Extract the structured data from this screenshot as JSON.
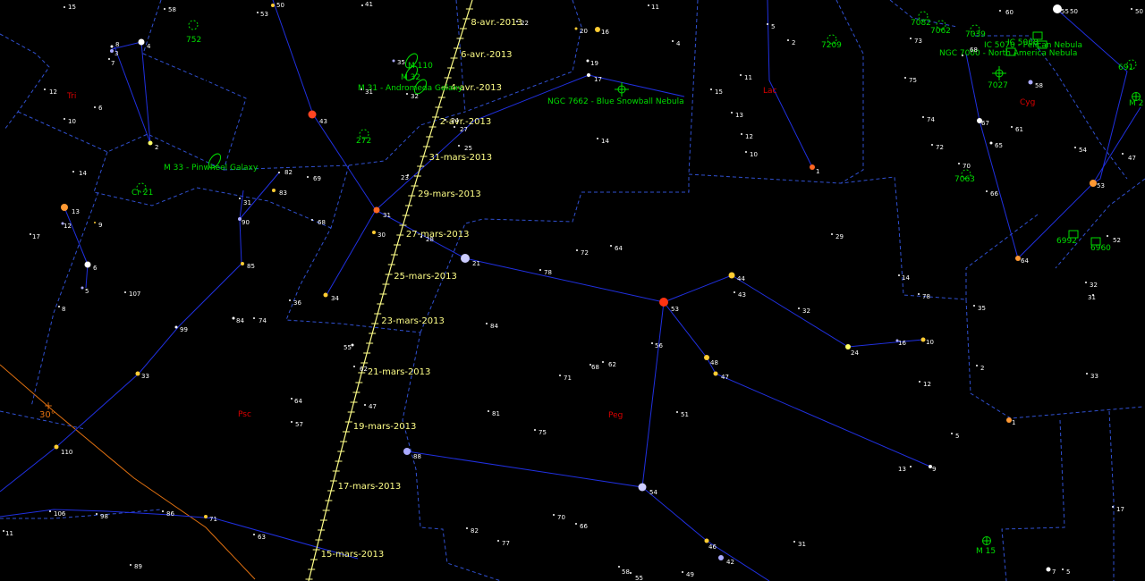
{
  "colors": {
    "background": "#000000",
    "boundary": "#3050d0",
    "constellation_line": "#2030e0",
    "constellation_name": "#dd0000",
    "deep_sky": "#00dd00",
    "star_label": "#ffffff",
    "comet_track": "#ffff88",
    "grid_line": "#e07010"
  },
  "grid_label": "30°",
  "constellations": [
    {
      "name": "Tri"
    },
    {
      "name": "Psc"
    },
    {
      "name": "Peg"
    },
    {
      "name": "Lac"
    },
    {
      "name": "Cyg"
    }
  ],
  "comet_dates": [
    "8-avr.-2013",
    "6-avr.-2013",
    "4-avr.-2013",
    "2-avr.-2013",
    "31-mars-2013",
    "29-mars-2013",
    "27-mars-2013",
    "25-mars-2013",
    "23-mars-2013",
    "21-mars-2013",
    "19-mars-2013",
    "17-mars-2013",
    "15-mars-2013"
  ],
  "deep_sky_objects": [
    {
      "label": "752",
      "icon": "open-cluster-icon"
    },
    {
      "label": "M 110",
      "icon": "galaxy-icon"
    },
    {
      "label": "M 32",
      "icon": "galaxy-icon"
    },
    {
      "label": "M 31 - Andromeda Galaxy",
      "icon": "galaxy-icon"
    },
    {
      "label": "272",
      "icon": "open-cluster-icon"
    },
    {
      "label": "M 33 - Pinwheel Galaxy",
      "icon": "galaxy-icon"
    },
    {
      "label": "Cr 21",
      "icon": "open-cluster-icon"
    },
    {
      "label": "NGC 7662 - Blue Snowball Nebula",
      "icon": "planetary-nebula-icon"
    },
    {
      "label": "7209",
      "icon": "open-cluster-icon"
    },
    {
      "label": "7082",
      "icon": "open-cluster-icon"
    },
    {
      "label": "7062",
      "icon": "open-cluster-icon"
    },
    {
      "label": "7039",
      "icon": "open-cluster-icon"
    },
    {
      "label": "IC 5068",
      "icon": "nebula-icon"
    },
    {
      "label": "IC 5070 - Pelican Nebula",
      "icon": "nebula-icon"
    },
    {
      "label": "NGC 7000 - North America Nebula",
      "icon": "nebula-icon"
    },
    {
      "label": "7027",
      "icon": "planetary-nebula-icon"
    },
    {
      "label": "7063",
      "icon": "open-cluster-icon"
    },
    {
      "label": "6992",
      "icon": "nebula-icon"
    },
    {
      "label": "6960",
      "icon": "nebula-icon"
    },
    {
      "label": "M 15",
      "icon": "globular-cluster-icon"
    },
    {
      "label": "691",
      "icon": "open-cluster-icon"
    },
    {
      "label": "M 2",
      "icon": "globular-cluster-icon"
    }
  ],
  "stars": [
    {
      "label": "15",
      "color": "#ffffff"
    },
    {
      "label": "58",
      "color": "#ffffff"
    },
    {
      "label": "53",
      "color": "#ffffff"
    },
    {
      "label": "50",
      "color": "#ffcc33"
    },
    {
      "label": "41",
      "color": "#ffffff"
    },
    {
      "label": "22",
      "color": "#ffffff"
    },
    {
      "label": "11",
      "color": "#ffffff"
    },
    {
      "label": "50",
      "color": "#ffffff"
    },
    {
      "label": "8",
      "color": "#ffffff"
    },
    {
      "label": "3",
      "color": "#aaaaff"
    },
    {
      "label": "7",
      "color": "#ffffff"
    },
    {
      "label": "4",
      "color": "#ffffff"
    },
    {
      "label": "12",
      "color": "#ffffff"
    },
    {
      "label": "6",
      "color": "#ffffff"
    },
    {
      "label": "10",
      "color": "#ffffff"
    },
    {
      "label": "2",
      "color": "#ffff66"
    },
    {
      "label": "14",
      "color": "#ffffff"
    },
    {
      "label": "13",
      "color": "#ff9933"
    },
    {
      "label": "12",
      "color": "#aaaaff"
    },
    {
      "label": "9",
      "color": "#ffcc33"
    },
    {
      "label": "17",
      "color": "#ffffff"
    },
    {
      "label": "6",
      "color": "#ffffff"
    },
    {
      "label": "5",
      "color": "#aaaaff"
    },
    {
      "label": "8",
      "color": "#ffffff"
    },
    {
      "label": "107",
      "color": "#ffffff"
    },
    {
      "label": "35",
      "color": "#aaaaff"
    },
    {
      "label": "31",
      "color": "#ffffff"
    },
    {
      "label": "43",
      "color": "#ff4422"
    },
    {
      "label": "32",
      "color": "#ffffff"
    },
    {
      "label": "82",
      "color": "#ffffff"
    },
    {
      "label": "69",
      "color": "#ffffff"
    },
    {
      "label": "83",
      "color": "#ffcc33"
    },
    {
      "label": "31",
      "color": "#ffffff"
    },
    {
      "label": "90",
      "color": "#aaaaff"
    },
    {
      "label": "68",
      "color": "#ffffff"
    },
    {
      "label": "85",
      "color": "#ffcc33"
    },
    {
      "label": "84",
      "color": "#ffffff"
    },
    {
      "label": "74",
      "color": "#ffffff"
    },
    {
      "label": "36",
      "color": "#ffffff"
    },
    {
      "label": "99",
      "color": "#ffffff"
    },
    {
      "label": "33",
      "color": "#ffcc33"
    },
    {
      "label": "110",
      "color": "#ffcc33"
    },
    {
      "label": "106",
      "color": "#ffffff"
    },
    {
      "label": "98",
      "color": "#ffffff"
    },
    {
      "label": "86",
      "color": "#ffffff"
    },
    {
      "label": "71",
      "color": "#ffcc33"
    },
    {
      "label": "63",
      "color": "#ffffff"
    },
    {
      "label": "89",
      "color": "#ffffff"
    },
    {
      "label": "11",
      "color": "#ffffff"
    },
    {
      "label": "64",
      "color": "#ffffff"
    },
    {
      "label": "57",
      "color": "#ffffff"
    },
    {
      "label": "47",
      "color": "#ffffff"
    },
    {
      "label": "34",
      "color": "#ffcc33"
    },
    {
      "label": "30",
      "color": "#ffcc33"
    },
    {
      "label": "31",
      "color": "#ff6622"
    },
    {
      "label": "55",
      "color": "#ffffff"
    },
    {
      "label": "62",
      "color": "#ffffff"
    },
    {
      "label": "23",
      "color": "#ffffff"
    },
    {
      "label": "27",
      "color": "#ffffff"
    },
    {
      "label": "25",
      "color": "#ffffff"
    },
    {
      "label": "24",
      "color": "#ffffff"
    },
    {
      "label": "28",
      "color": "#ffffff"
    },
    {
      "label": "20",
      "color": "#ffcc33"
    },
    {
      "label": "16",
      "color": "#ffcc33"
    },
    {
      "label": "4",
      "color": "#ffffff"
    },
    {
      "label": "19",
      "color": "#ffffff"
    },
    {
      "label": "17",
      "color": "#ffffff"
    },
    {
      "label": "14",
      "color": "#ffffff"
    },
    {
      "label": "5",
      "color": "#ffffff"
    },
    {
      "label": "2",
      "color": "#ffffff"
    },
    {
      "label": "15",
      "color": "#ffffff"
    },
    {
      "label": "11",
      "color": "#ffffff"
    },
    {
      "label": "13",
      "color": "#ffffff"
    },
    {
      "label": "12",
      "color": "#ffffff"
    },
    {
      "label": "10",
      "color": "#ffffff"
    },
    {
      "label": "1",
      "color": "#ff6622"
    },
    {
      "label": "21",
      "color": "#ccccff"
    },
    {
      "label": "78",
      "color": "#ffffff"
    },
    {
      "label": "72",
      "color": "#ffffff"
    },
    {
      "label": "64",
      "color": "#ffffff"
    },
    {
      "label": "29",
      "color": "#ffffff"
    },
    {
      "label": "84",
      "color": "#ffffff"
    },
    {
      "label": "44",
      "color": "#ffcc33"
    },
    {
      "label": "43",
      "color": "#ffffff"
    },
    {
      "label": "53",
      "color": "#ff3311"
    },
    {
      "label": "32",
      "color": "#ffffff"
    },
    {
      "label": "56",
      "color": "#ffffff"
    },
    {
      "label": "48",
      "color": "#ffcc33"
    },
    {
      "label": "47",
      "color": "#ffcc33"
    },
    {
      "label": "71",
      "color": "#ffffff"
    },
    {
      "label": "68",
      "color": "#ffffff"
    },
    {
      "label": "62",
      "color": "#ffffff"
    },
    {
      "label": "81",
      "color": "#ffffff"
    },
    {
      "label": "75",
      "color": "#ffffff"
    },
    {
      "label": "51",
      "color": "#ffffff"
    },
    {
      "label": "24",
      "color": "#ffff66"
    },
    {
      "label": "16",
      "color": "#aaaaff"
    },
    {
      "label": "10",
      "color": "#ffcc33"
    },
    {
      "label": "88",
      "color": "#aaaaff"
    },
    {
      "label": "54",
      "color": "#ccccff"
    },
    {
      "label": "70",
      "color": "#ffffff"
    },
    {
      "label": "66",
      "color": "#ffffff"
    },
    {
      "label": "82",
      "color": "#ffffff"
    },
    {
      "label": "77",
      "color": "#ffffff"
    },
    {
      "label": "46",
      "color": "#ffcc33"
    },
    {
      "label": "42",
      "color": "#aaaaff"
    },
    {
      "label": "31",
      "color": "#ffffff"
    },
    {
      "label": "58",
      "color": "#ffffff"
    },
    {
      "label": "55",
      "color": "#ffffff"
    },
    {
      "label": "49",
      "color": "#ffffff"
    },
    {
      "label": "12",
      "color": "#ffffff"
    },
    {
      "label": "13",
      "color": "#ffffff"
    },
    {
      "label": "9",
      "color": "#ffffff"
    },
    {
      "label": "5",
      "color": "#ffffff"
    },
    {
      "label": "73",
      "color": "#ffffff"
    },
    {
      "label": "68",
      "color": "#ffffff"
    },
    {
      "label": "60",
      "color": "#ffffff"
    },
    {
      "label": "55",
      "color": "#ffffff"
    },
    {
      "label": "50",
      "color": "#ffffff"
    },
    {
      "label": "75",
      "color": "#ffffff"
    },
    {
      "label": "58",
      "color": "#aaaaff"
    },
    {
      "label": "74",
      "color": "#ffffff"
    },
    {
      "label": "72",
      "color": "#ffffff"
    },
    {
      "label": "67",
      "color": "#ffffff"
    },
    {
      "label": "65",
      "color": "#ffffff"
    },
    {
      "label": "61",
      "color": "#ffffff"
    },
    {
      "label": "70",
      "color": "#ffffff"
    },
    {
      "label": "66",
      "color": "#ffffff"
    },
    {
      "label": "54",
      "color": "#ffffff"
    },
    {
      "label": "47",
      "color": "#ffffff"
    },
    {
      "label": "53",
      "color": "#ff9933"
    },
    {
      "label": "52",
      "color": "#ffffff"
    },
    {
      "label": "64",
      "color": "#ff9933"
    },
    {
      "label": "14",
      "color": "#ffffff"
    },
    {
      "label": "78",
      "color": "#ffffff"
    },
    {
      "label": "35",
      "color": "#ffffff"
    },
    {
      "label": "32",
      "color": "#ffffff"
    },
    {
      "label": "31",
      "color": "#ffffff"
    },
    {
      "label": "2",
      "color": "#ffffff"
    },
    {
      "label": "33",
      "color": "#ffffff"
    },
    {
      "label": "1",
      "color": "#ff9933"
    },
    {
      "label": "17",
      "color": "#ffffff"
    },
    {
      "label": "7",
      "color": "#ffffff"
    },
    {
      "label": "5",
      "color": "#ffffff"
    }
  ]
}
